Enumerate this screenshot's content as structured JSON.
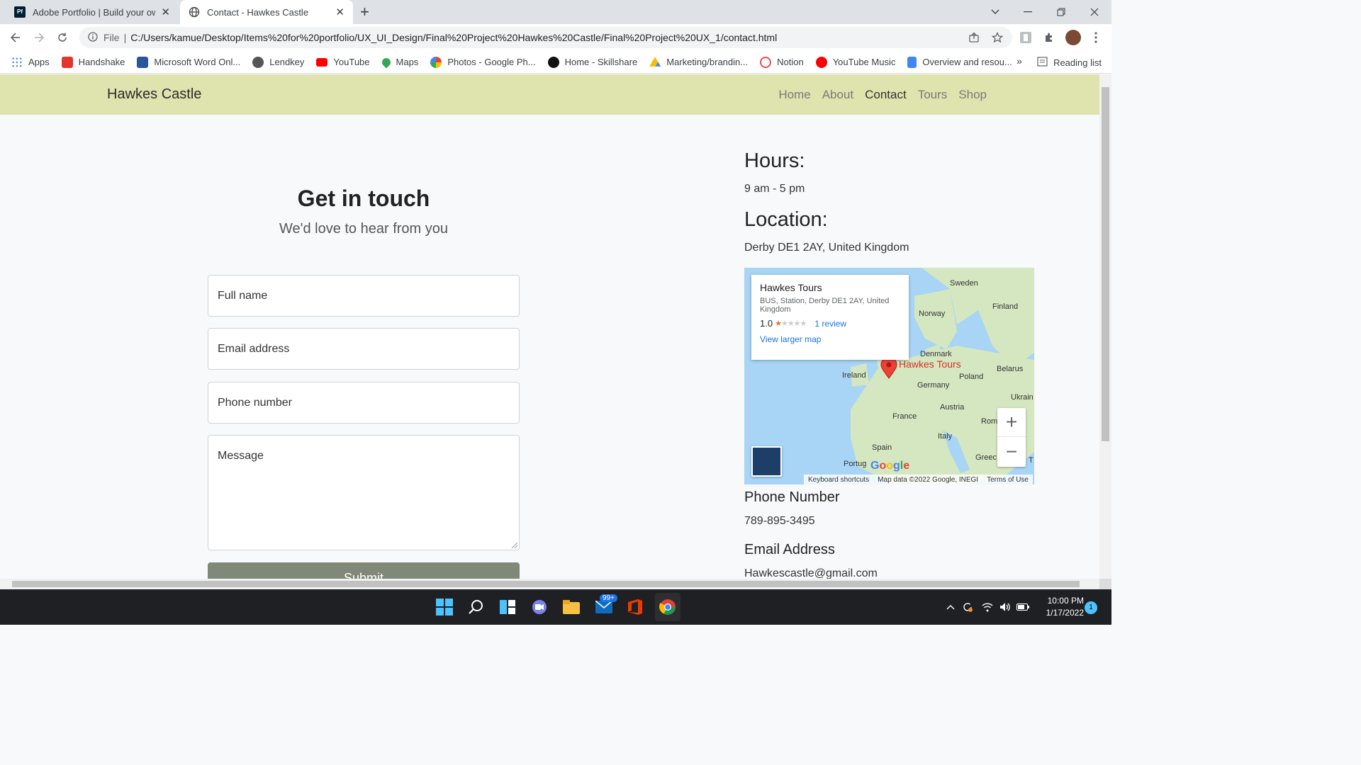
{
  "browser": {
    "tabs": [
      {
        "title": "Adobe Portfolio | Build your own",
        "icon": "adobe-portfolio-icon",
        "active": false
      },
      {
        "title": "Contact - Hawkes Castle",
        "icon": "globe-icon",
        "active": true
      }
    ],
    "address": {
      "scheme_label": "File",
      "url": "C:/Users/kamue/Desktop/Items%20for%20portfolio/UX_UI_Design/Final%20Project%20Hawkes%20Castle/Final%20Project%20UX_1/contact.html"
    },
    "bookmarks": [
      {
        "label": "Apps",
        "color": "#4285f4"
      },
      {
        "label": "Handshake",
        "color": "#e0362c"
      },
      {
        "label": "Microsoft Word Onl...",
        "color": "#2b579a"
      },
      {
        "label": "Lendkey",
        "color": "#555555"
      },
      {
        "label": "YouTube",
        "color": "#ff0000"
      },
      {
        "label": "Maps",
        "color": "#34a853"
      },
      {
        "label": "Photos - Google Ph...",
        "color": "#fbbc04"
      },
      {
        "label": "Home - Skillshare",
        "color": "#111111"
      },
      {
        "label": "Marketing/brandin...",
        "color": "#0f9d58"
      },
      {
        "label": "Notion",
        "color": "#e94f4f"
      },
      {
        "label": "YouTube Music",
        "color": "#ff0000"
      },
      {
        "label": "Overview and resou...",
        "color": "#4285f4"
      }
    ],
    "bookmarks_more": "»",
    "reading_list": "Reading list"
  },
  "site": {
    "brand": "Hawkes Castle",
    "nav": [
      "Home",
      "About",
      "Contact",
      "Tours",
      "Shop"
    ],
    "active_nav": "Contact",
    "nav_color": "#dfe3ae"
  },
  "contact": {
    "heading": "Get in touch",
    "subheading": "We'd love to hear from you",
    "fields": {
      "full_name": "Full name",
      "email": "Email address",
      "phone": "Phone number",
      "message": "Message"
    },
    "submit": "Submit"
  },
  "info": {
    "hours_title": "Hours:",
    "hours": "9 am - 5 pm",
    "location_title": "Location:",
    "location": "Derby DE1 2AY, United Kingdom",
    "phone_title": "Phone Number",
    "phone": "789-895-3495",
    "email_title": "Email Address",
    "email": "Hawkescastle@gmail.com"
  },
  "map": {
    "place_name": "Hawkes Tours",
    "address": "BUS, Station, Derby DE1 2AY, United Kingdom",
    "rating": "1.0",
    "stars_filled": 1,
    "stars_total": 5,
    "reviews": "1 review",
    "larger_map": "View larger map",
    "pin_label": "Hawkes Tours",
    "logo": "Google",
    "footer": [
      "Keyboard shortcuts",
      "Map data ©2022 Google, INEGI",
      "Terms of Use"
    ],
    "countries": {
      "sweden": "Sweden",
      "finland": "Finland",
      "norway": "Norway",
      "denmark": "Denmark",
      "belarus": "Belarus",
      "ireland": "Ireland",
      "poland": "Poland",
      "germany": "Germany",
      "ukraine": "Ukrain",
      "austria": "Austria",
      "france": "France",
      "romania": "Rom",
      "italy": "Italy",
      "spain": "Spain",
      "portugal": "Portug",
      "greece": "Greec",
      "turkey": "T"
    }
  },
  "taskbar": {
    "mail_badge": "99+",
    "time": "10:00 PM",
    "date": "1/17/2022",
    "notifications": "1"
  }
}
